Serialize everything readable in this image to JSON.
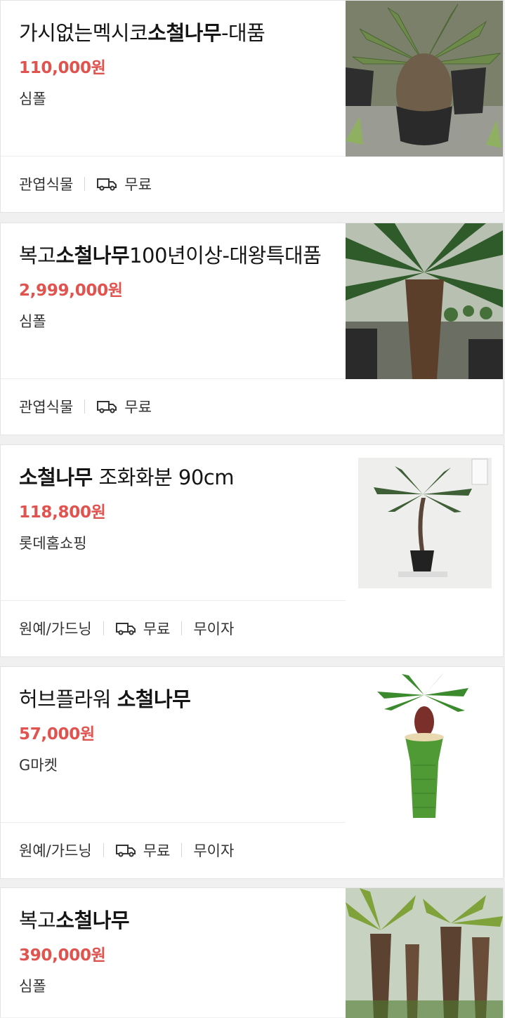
{
  "items": [
    {
      "title_plain_before": "가시없는멕시코",
      "title_bold": "소철나무",
      "title_plain_after": "-대품",
      "price": "110,000원",
      "seller": "심폴",
      "category": "관엽식물",
      "shipping": "무료",
      "installment": ""
    },
    {
      "title_plain_before": "복고",
      "title_bold": "소철나무",
      "title_plain_after": "100년이상-대왕특대품",
      "price": "2,999,000원",
      "seller": "심폴",
      "category": "관엽식물",
      "shipping": "무료",
      "installment": ""
    },
    {
      "title_plain_before": "",
      "title_bold": "소철나무",
      "title_plain_after": " 조화화분 90cm",
      "price": "118,800원",
      "seller": "롯데홈쇼핑",
      "category": "원예/가드닝",
      "shipping": "무료",
      "installment": "무이자"
    },
    {
      "title_plain_before": "허브플라워 ",
      "title_bold": "소철나무",
      "title_plain_after": "",
      "price": "57,000원",
      "seller": "G마켓",
      "category": "원예/가드닝",
      "shipping": "무료",
      "installment": "무이자"
    },
    {
      "title_plain_before": "복고",
      "title_bold": "소철나무",
      "title_plain_after": "",
      "price": "390,000원",
      "seller": "심폴",
      "category": "",
      "shipping": "",
      "installment": ""
    }
  ],
  "icons": {
    "shipping_icon": "truck-icon"
  },
  "colors": {
    "price": "#e0534f",
    "background": "#f0f0f0",
    "card": "#ffffff"
  }
}
